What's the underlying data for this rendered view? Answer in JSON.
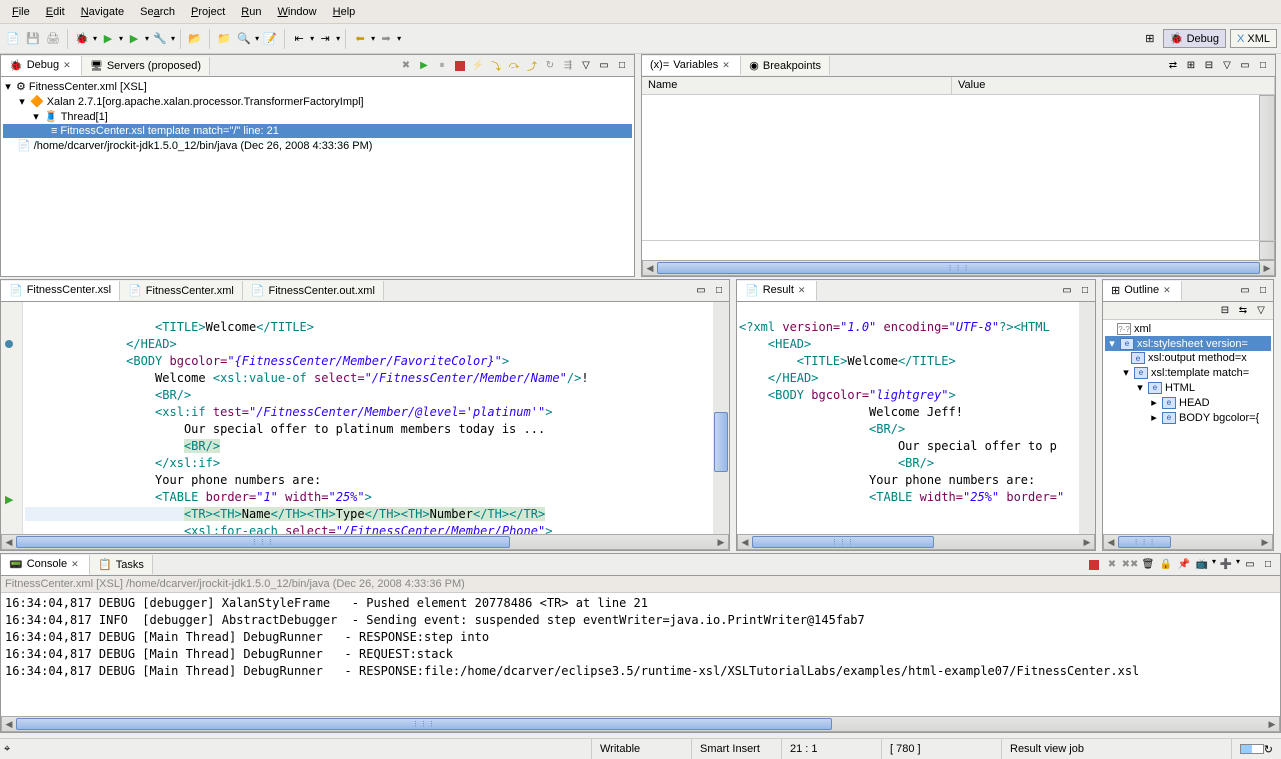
{
  "menu": {
    "file": "File",
    "edit": "Edit",
    "navigate": "Navigate",
    "search": "Search",
    "project": "Project",
    "run": "Run",
    "window": "Window",
    "help": "Help"
  },
  "perspectives": {
    "debug": "Debug",
    "xml": "XML"
  },
  "debugView": {
    "tab_debug": "Debug",
    "tab_servers": "Servers (proposed)",
    "item0": "FitnessCenter.xml [XSL]",
    "item1": "Xalan 2.7.1[org.apache.xalan.processor.TransformerFactoryImpl]",
    "item2": "Thread[1]",
    "item3": "FitnessCenter.xsl template match=\"/\" line: 21",
    "item4": "/home/dcarver/jrockit-jdk1.5.0_12/bin/java (Dec 26, 2008 4:33:36 PM)"
  },
  "varsView": {
    "tab_vars": "Variables",
    "tab_bp": "Breakpoints",
    "col_name": "Name",
    "col_value": "Value"
  },
  "editorTabs": {
    "t1": "FitnessCenter.xsl",
    "t2": "FitnessCenter.xml",
    "t3": "FitnessCenter.out.xml"
  },
  "resultTab": "Result",
  "outline": {
    "tab": "Outline",
    "i0": "xml",
    "i1": "xsl:stylesheet version=",
    "i2": "xsl:output method=x",
    "i3": "xsl:template match=",
    "i4": "HTML",
    "i5": "HEAD",
    "i6": "BODY bgcolor={"
  },
  "consoleTabs": {
    "console": "Console",
    "tasks": "Tasks"
  },
  "consoleTitle": "FitnessCenter.xml [XSL] /home/dcarver/jrockit-jdk1.5.0_12/bin/java (Dec 26, 2008 4:33:36 PM)",
  "consoleLines": "16:34:04,817 DEBUG [debugger] XalanStyleFrame   - Pushed element 20778486 <TR> at line 21\n16:34:04,817 INFO  [debugger] AbstractDebugger  - Sending event: suspended step eventWriter=java.io.PrintWriter@145fab7\n16:34:04,817 DEBUG [Main Thread] DebugRunner   - RESPONSE:step into\n16:34:04,817 DEBUG [Main Thread] DebugRunner   - REQUEST:stack\n16:34:04,817 DEBUG [Main Thread] DebugRunner   - RESPONSE:file:/home/dcarver/eclipse3.5/runtime-xsl/XSLTutorialLabs/examples/html-example07/FitnessCenter.xsl",
  "status": {
    "writable": "Writable",
    "smart": "Smart Insert",
    "pos": "21 : 1",
    "chars": "[ 780 ]",
    "job": "Result view job"
  }
}
